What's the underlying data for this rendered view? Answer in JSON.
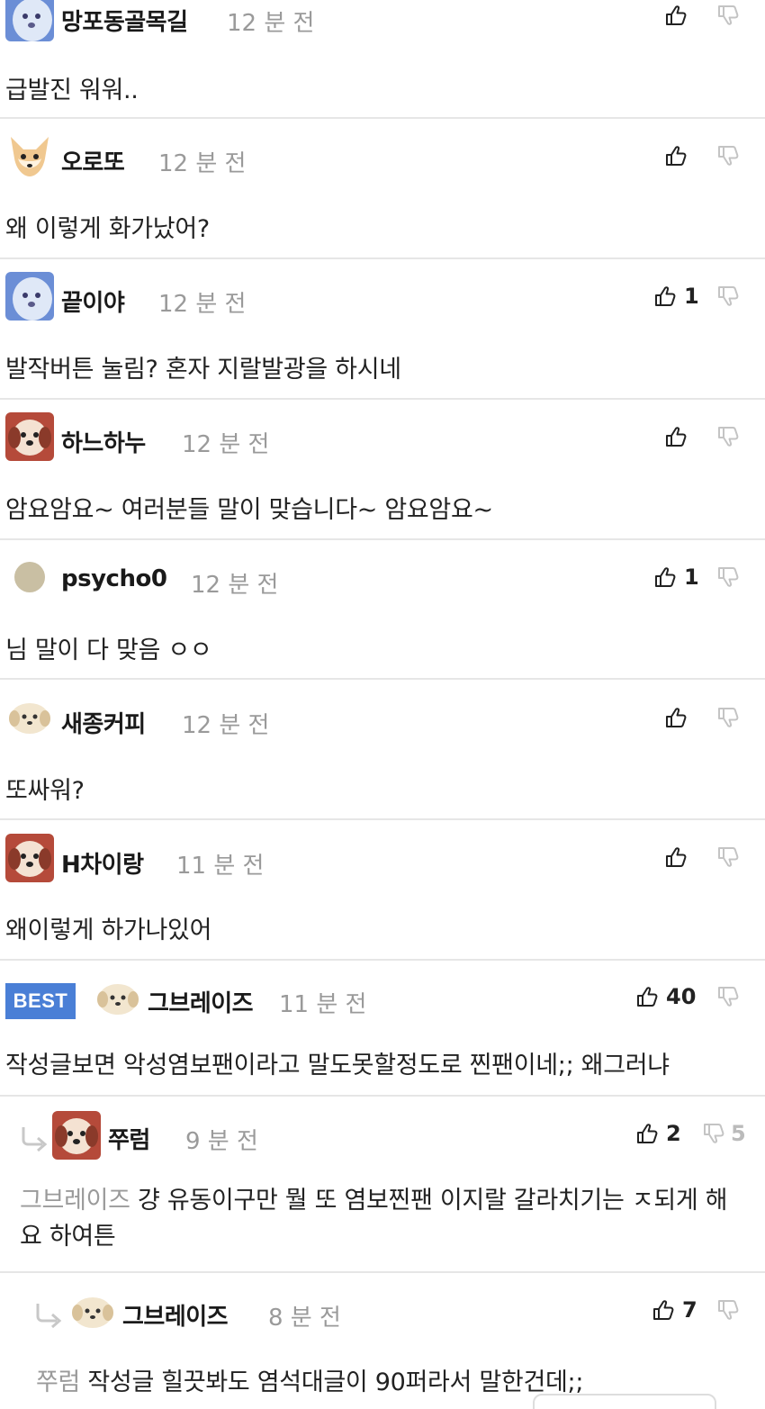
{
  "comments": [
    {
      "nick": "망포동골목길",
      "time": "12 분 전",
      "body": "급발진 워워..",
      "likes": ""
    },
    {
      "nick": "오로또",
      "time": "12 분 전",
      "body": "왜 이렇게 화가났어?",
      "likes": ""
    },
    {
      "nick": "끝이야",
      "time": "12 분 전",
      "body": "발작버튼 눌림? 혼자 지랄발광을 하시네",
      "likes": "1"
    },
    {
      "nick": "하느하누",
      "time": "12 분 전",
      "body": "암요암요~ 여러분들 말이 맞습니다~ 암요암요~",
      "likes": ""
    },
    {
      "nick": "psycho0",
      "time": "12 분 전",
      "body": "님 말이 다 맞음 ㅇㅇ",
      "likes": "1"
    },
    {
      "nick": "새종커피",
      "time": "12 분 전",
      "body": "또싸워?",
      "likes": ""
    },
    {
      "nick": "H차이랑",
      "time": "11 분 전",
      "body": "왜이렇게 하가나있어",
      "likes": ""
    },
    {
      "badge": "BEST",
      "nick": "그브레이즈",
      "time": "11 분 전",
      "body": "작성글보면 악성염보팬이라고 말도못할정도로 찐팬이네;; 왜그러냐",
      "likes": "40"
    }
  ],
  "replies": [
    {
      "nick": "쭈럼",
      "time": "9 분 전",
      "mention": "그브레이즈",
      "body": "걍 유동이구만 뭘 또 염보찐팬 이지랄 갈라치기는 ㅈ되게 해요 하여튼",
      "likes": "2",
      "dislikes": "5"
    },
    {
      "nick": "그브레이즈",
      "time": "8 분 전",
      "mention": "쭈럼",
      "body": "작성글 힐끗봐도 염석대글이 90퍼라서 말한건데;;",
      "likes": "7",
      "dislikes": ""
    }
  ],
  "icons": {
    "like": "thumbs-up-icon",
    "dislike": "thumbs-down-icon",
    "reply": "reply-arrow-icon"
  },
  "colors": {
    "best_badge": "#4a7fd6",
    "time_text": "#9a9a9a",
    "divider": "#e6e6e6"
  }
}
